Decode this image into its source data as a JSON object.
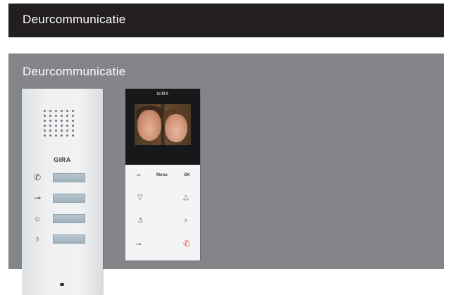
{
  "header": {
    "title": "Deurcommunicatie"
  },
  "panel": {
    "title": "Deurcommunicatie",
    "audio_station": {
      "brand": "GIRA",
      "icons": [
        "handset-icon",
        "key-icon",
        "light-icon",
        "bell-off-icon"
      ]
    },
    "video_station": {
      "brand": "GIRA",
      "labels": {
        "menu": "Menu",
        "ok": "OK"
      }
    }
  },
  "colors": {
    "header_bg": "#231f20",
    "panel_bg": "#838589",
    "text": "#ffffff"
  }
}
